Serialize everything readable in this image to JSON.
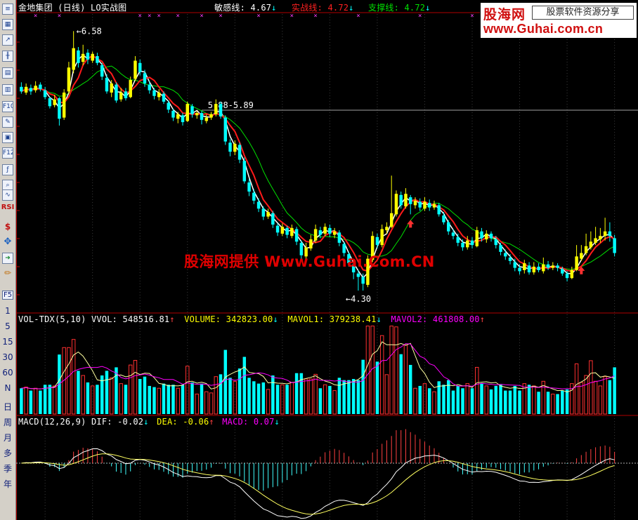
{
  "toolbar": {
    "icons": [
      "list-icon",
      "grid-icon",
      "line-chart-icon",
      "candlestick-icon",
      "table-icon",
      "report-icon",
      "f10-icon",
      "notes-icon",
      "document-icon",
      "f12-icon",
      "formula-icon",
      "search-icon",
      "indicator-icon",
      "rsi-icon",
      "money-icon",
      "move-icon",
      "exit-icon",
      "pencil-icon",
      "f5-icon"
    ],
    "rsi_label": "RSI",
    "f5_label": "F5",
    "period_buttons": [
      "1",
      "5",
      "15",
      "30",
      "60",
      "N",
      "日",
      "周",
      "月",
      "多",
      "季",
      "年"
    ]
  },
  "header": {
    "stock_name": "金地集团",
    "period": "(日线)",
    "chart_name": "LO实战图",
    "sensitive_label": "敏感线:",
    "sensitive_value": "4.67",
    "sensitive_arrow": "↓",
    "combat_label": "实战线:",
    "combat_value": "4.72",
    "combat_arrow": "↓",
    "support_label": "支撑线:",
    "support_value": "4.72",
    "support_arrow": "↓"
  },
  "logo": {
    "name": "股海网",
    "tagline": "股票软件资源分享",
    "url": "www.Guhai.com.cn"
  },
  "watermark": "股海网提供 Www.Guhai.Com.CN",
  "colors": {
    "background": "#000000",
    "up": "#ffff00",
    "down": "#00ffff",
    "red_line": "#ff1a1a",
    "green_line": "#00e000",
    "white_line": "#ffffff",
    "magenta": "#ff00ff",
    "divider": "#b00000"
  },
  "chart_data": [
    {
      "type": "candlestick",
      "title": "金地集团 (日线) LO实战图",
      "ylim": [
        4.14,
        6.73
      ],
      "annotations": {
        "high_label": "6.58",
        "low_label": "4.30",
        "resistance_label": "5.88-5.89",
        "resistance_level": 5.885
      },
      "series": {
        "sensitive": 4.67,
        "combat": 4.72,
        "support": 4.72
      },
      "candles": [
        {
          "o": 6.09,
          "c": 6.05,
          "h": 6.13,
          "l": 6.03
        },
        {
          "o": 6.04,
          "c": 6.09,
          "h": 6.12,
          "l": 6.02
        },
        {
          "o": 6.08,
          "c": 6.05,
          "h": 6.11,
          "l": 6.02
        },
        {
          "o": 6.06,
          "c": 6.1,
          "h": 6.14,
          "l": 6.04
        },
        {
          "o": 6.11,
          "c": 6.07,
          "h": 6.13,
          "l": 6.05
        },
        {
          "o": 6.06,
          "c": 6.0,
          "h": 6.09,
          "l": 5.98
        },
        {
          "o": 5.99,
          "c": 5.92,
          "h": 6.0,
          "l": 5.9
        },
        {
          "o": 5.93,
          "c": 5.98,
          "h": 6.02,
          "l": 5.91
        },
        {
          "o": 5.99,
          "c": 5.81,
          "h": 6.0,
          "l": 5.75
        },
        {
          "o": 5.82,
          "c": 6.04,
          "h": 6.07,
          "l": 5.8
        },
        {
          "o": 6.05,
          "c": 6.26,
          "h": 6.31,
          "l": 6.03
        },
        {
          "o": 6.24,
          "c": 6.43,
          "h": 6.58,
          "l": 6.21
        },
        {
          "o": 6.41,
          "c": 6.3,
          "h": 6.44,
          "l": 6.26
        },
        {
          "o": 6.31,
          "c": 6.38,
          "h": 6.46,
          "l": 6.28
        },
        {
          "o": 6.39,
          "c": 6.33,
          "h": 6.42,
          "l": 6.29
        },
        {
          "o": 6.32,
          "c": 6.38,
          "h": 6.4,
          "l": 6.3
        },
        {
          "o": 6.36,
          "c": 6.3,
          "h": 6.39,
          "l": 6.28
        },
        {
          "o": 6.28,
          "c": 6.18,
          "h": 6.3,
          "l": 6.15
        },
        {
          "o": 6.17,
          "c": 6.05,
          "h": 6.2,
          "l": 6.03
        },
        {
          "o": 6.04,
          "c": 6.12,
          "h": 6.15,
          "l": 6.0
        },
        {
          "o": 6.11,
          "c": 5.97,
          "h": 6.13,
          "l": 5.95
        },
        {
          "o": 5.98,
          "c": 6.04,
          "h": 6.08,
          "l": 5.96
        },
        {
          "o": 6.05,
          "c": 5.99,
          "h": 6.08,
          "l": 5.97
        },
        {
          "o": 6.0,
          "c": 6.15,
          "h": 6.18,
          "l": 5.99
        },
        {
          "o": 6.16,
          "c": 6.32,
          "h": 6.36,
          "l": 6.14
        },
        {
          "o": 6.3,
          "c": 6.22,
          "h": 6.33,
          "l": 6.19
        },
        {
          "o": 6.21,
          "c": 6.12,
          "h": 6.24,
          "l": 6.09
        },
        {
          "o": 6.11,
          "c": 6.06,
          "h": 6.14,
          "l": 6.03
        },
        {
          "o": 6.06,
          "c": 6.01,
          "h": 6.08,
          "l": 5.98
        },
        {
          "o": 6.0,
          "c": 6.04,
          "h": 6.07,
          "l": 5.97
        },
        {
          "o": 6.03,
          "c": 5.96,
          "h": 6.05,
          "l": 5.94
        },
        {
          "o": 5.95,
          "c": 5.89,
          "h": 5.97,
          "l": 5.86
        },
        {
          "o": 5.88,
          "c": 5.82,
          "h": 5.9,
          "l": 5.79
        },
        {
          "o": 5.81,
          "c": 5.85,
          "h": 5.87,
          "l": 5.77
        },
        {
          "o": 5.84,
          "c": 5.78,
          "h": 5.86,
          "l": 5.75
        },
        {
          "o": 5.79,
          "c": 5.94,
          "h": 5.96,
          "l": 5.78
        },
        {
          "o": 5.92,
          "c": 5.85,
          "h": 5.94,
          "l": 5.82
        },
        {
          "o": 5.84,
          "c": 5.86,
          "h": 5.88,
          "l": 5.81
        },
        {
          "o": 5.86,
          "c": 5.8,
          "h": 5.88,
          "l": 5.76
        },
        {
          "o": 5.79,
          "c": 5.82,
          "h": 5.85,
          "l": 5.77
        },
        {
          "o": 5.82,
          "c": 5.85,
          "h": 5.87,
          "l": 5.8
        },
        {
          "o": 5.85,
          "c": 5.94,
          "h": 5.98,
          "l": 5.83
        },
        {
          "o": 5.94,
          "c": 5.83,
          "h": 5.96,
          "l": 5.81
        },
        {
          "o": 5.82,
          "c": 5.61,
          "h": 5.84,
          "l": 5.58
        },
        {
          "o": 5.6,
          "c": 5.52,
          "h": 5.63,
          "l": 5.48
        },
        {
          "o": 5.52,
          "c": 5.59,
          "h": 5.62,
          "l": 5.49
        },
        {
          "o": 5.58,
          "c": 5.45,
          "h": 5.6,
          "l": 5.42
        },
        {
          "o": 5.44,
          "c": 5.26,
          "h": 5.47,
          "l": 5.24
        },
        {
          "o": 5.25,
          "c": 5.17,
          "h": 5.28,
          "l": 5.13
        },
        {
          "o": 5.16,
          "c": 5.09,
          "h": 5.19,
          "l": 5.06
        },
        {
          "o": 5.08,
          "c": 5.02,
          "h": 5.11,
          "l": 4.99
        },
        {
          "o": 5.02,
          "c": 4.95,
          "h": 5.04,
          "l": 4.92
        },
        {
          "o": 4.95,
          "c": 4.99,
          "h": 5.02,
          "l": 4.93
        },
        {
          "o": 4.98,
          "c": 4.88,
          "h": 5.0,
          "l": 4.85
        },
        {
          "o": 4.87,
          "c": 4.81,
          "h": 4.89,
          "l": 4.78
        },
        {
          "o": 4.8,
          "c": 4.86,
          "h": 4.89,
          "l": 4.78
        },
        {
          "o": 4.85,
          "c": 4.79,
          "h": 4.87,
          "l": 4.76
        },
        {
          "o": 4.78,
          "c": 4.85,
          "h": 4.88,
          "l": 4.76
        },
        {
          "o": 4.84,
          "c": 4.73,
          "h": 4.86,
          "l": 4.7
        },
        {
          "o": 4.72,
          "c": 4.61,
          "h": 4.74,
          "l": 4.58
        },
        {
          "o": 4.6,
          "c": 4.68,
          "h": 4.72,
          "l": 4.58
        },
        {
          "o": 4.67,
          "c": 4.75,
          "h": 4.79,
          "l": 4.65
        },
        {
          "o": 4.74,
          "c": 4.84,
          "h": 4.88,
          "l": 4.72
        },
        {
          "o": 4.83,
          "c": 4.79,
          "h": 4.86,
          "l": 4.76
        },
        {
          "o": 4.8,
          "c": 4.86,
          "h": 4.89,
          "l": 4.78
        },
        {
          "o": 4.85,
          "c": 4.8,
          "h": 4.88,
          "l": 4.77
        },
        {
          "o": 4.79,
          "c": 4.82,
          "h": 4.85,
          "l": 4.76
        },
        {
          "o": 4.81,
          "c": 4.72,
          "h": 4.83,
          "l": 4.69
        },
        {
          "o": 4.71,
          "c": 4.63,
          "h": 4.73,
          "l": 4.6
        },
        {
          "o": 4.62,
          "c": 4.54,
          "h": 4.64,
          "l": 4.51
        },
        {
          "o": 4.53,
          "c": 4.46,
          "h": 4.55,
          "l": 4.4
        },
        {
          "o": 4.45,
          "c": 4.42,
          "h": 4.48,
          "l": 4.3
        },
        {
          "o": 4.42,
          "c": 4.36,
          "h": 4.45,
          "l": 4.3
        },
        {
          "o": 4.35,
          "c": 4.58,
          "h": 4.61,
          "l": 4.33
        },
        {
          "o": 4.57,
          "c": 4.78,
          "h": 4.82,
          "l": 4.55
        },
        {
          "o": 4.77,
          "c": 4.7,
          "h": 4.8,
          "l": 4.67
        },
        {
          "o": 4.7,
          "c": 4.84,
          "h": 4.88,
          "l": 4.68
        },
        {
          "o": 4.83,
          "c": 4.86,
          "h": 4.9,
          "l": 4.8
        },
        {
          "o": 4.86,
          "c": 4.98,
          "h": 5.31,
          "l": 4.85
        },
        {
          "o": 4.97,
          "c": 5.15,
          "h": 5.18,
          "l": 4.95
        },
        {
          "o": 5.14,
          "c": 5.05,
          "h": 5.17,
          "l": 5.02
        },
        {
          "o": 5.04,
          "c": 5.15,
          "h": 5.2,
          "l": 5.02
        },
        {
          "o": 5.12,
          "c": 5.06,
          "h": 5.14,
          "l": 4.97
        },
        {
          "o": 5.05,
          "c": 5.09,
          "h": 5.12,
          "l": 5.02
        },
        {
          "o": 5.08,
          "c": 5.03,
          "h": 5.11,
          "l": 5.0
        },
        {
          "o": 5.02,
          "c": 5.08,
          "h": 5.12,
          "l": 5.0
        },
        {
          "o": 5.07,
          "c": 5.03,
          "h": 5.1,
          "l": 5.0
        },
        {
          "o": 5.03,
          "c": 5.06,
          "h": 5.09,
          "l": 5.01
        },
        {
          "o": 5.05,
          "c": 4.97,
          "h": 5.07,
          "l": 4.95
        },
        {
          "o": 4.96,
          "c": 4.9,
          "h": 4.99,
          "l": 4.88
        },
        {
          "o": 4.9,
          "c": 4.82,
          "h": 4.92,
          "l": 4.79
        },
        {
          "o": 4.81,
          "c": 4.78,
          "h": 4.84,
          "l": 4.75
        },
        {
          "o": 4.77,
          "c": 4.72,
          "h": 4.8,
          "l": 4.69
        },
        {
          "o": 4.72,
          "c": 4.68,
          "h": 4.75,
          "l": 4.65
        },
        {
          "o": 4.68,
          "c": 4.74,
          "h": 4.78,
          "l": 4.66
        },
        {
          "o": 4.74,
          "c": 4.7,
          "h": 4.77,
          "l": 4.67
        },
        {
          "o": 4.69,
          "c": 4.83,
          "h": 4.86,
          "l": 4.68
        },
        {
          "o": 4.82,
          "c": 4.76,
          "h": 4.85,
          "l": 4.73
        },
        {
          "o": 4.75,
          "c": 4.8,
          "h": 4.83,
          "l": 4.72
        },
        {
          "o": 4.8,
          "c": 4.76,
          "h": 4.82,
          "l": 4.73
        },
        {
          "o": 4.75,
          "c": 4.7,
          "h": 4.78,
          "l": 4.67
        },
        {
          "o": 4.7,
          "c": 4.64,
          "h": 4.72,
          "l": 4.61
        },
        {
          "o": 4.63,
          "c": 4.6,
          "h": 4.66,
          "l": 4.57
        },
        {
          "o": 4.59,
          "c": 4.56,
          "h": 4.62,
          "l": 4.53
        },
        {
          "o": 4.55,
          "c": 4.5,
          "h": 4.58,
          "l": 4.47
        },
        {
          "o": 4.5,
          "c": 4.47,
          "h": 4.53,
          "l": 4.44
        },
        {
          "o": 4.48,
          "c": 4.54,
          "h": 4.57,
          "l": 4.45
        },
        {
          "o": 4.52,
          "c": 4.46,
          "h": 4.55,
          "l": 4.44
        },
        {
          "o": 4.46,
          "c": 4.51,
          "h": 4.55,
          "l": 4.44
        },
        {
          "o": 4.51,
          "c": 4.48,
          "h": 4.54,
          "l": 4.46
        },
        {
          "o": 4.47,
          "c": 4.53,
          "h": 4.59,
          "l": 4.45
        },
        {
          "o": 4.53,
          "c": 4.5,
          "h": 4.56,
          "l": 4.48
        },
        {
          "o": 4.5,
          "c": 4.52,
          "h": 4.55,
          "l": 4.48
        },
        {
          "o": 4.52,
          "c": 4.5,
          "h": 4.54,
          "l": 4.47
        },
        {
          "o": 4.49,
          "c": 4.45,
          "h": 4.51,
          "l": 4.43
        },
        {
          "o": 4.45,
          "c": 4.41,
          "h": 4.47,
          "l": 4.38
        },
        {
          "o": 4.41,
          "c": 4.48,
          "h": 4.51,
          "l": 4.4
        },
        {
          "o": 4.48,
          "c": 4.6,
          "h": 4.7,
          "l": 4.47
        },
        {
          "o": 4.58,
          "c": 4.63,
          "h": 4.7,
          "l": 4.56
        },
        {
          "o": 4.63,
          "c": 4.69,
          "h": 4.8,
          "l": 4.61
        },
        {
          "o": 4.68,
          "c": 4.73,
          "h": 4.82,
          "l": 4.66
        },
        {
          "o": 4.72,
          "c": 4.76,
          "h": 4.86,
          "l": 4.7
        },
        {
          "o": 4.75,
          "c": 4.78,
          "h": 4.85,
          "l": 4.72
        },
        {
          "o": 4.78,
          "c": 4.82,
          "h": 4.94,
          "l": 4.74
        },
        {
          "o": 4.82,
          "c": 4.78,
          "h": 4.9,
          "l": 4.73
        },
        {
          "o": 4.76,
          "c": 4.63,
          "h": 4.79,
          "l": 4.6
        }
      ],
      "signal_arrows_index": [
        82,
        118
      ]
    },
    {
      "type": "bar",
      "title": "VOL-TDX(5,10)",
      "vvol_label": "VVOL:",
      "vvol_value": "548516.81",
      "vvol_arrow": "↑",
      "volume_label": "VOLUME:",
      "volume_value": "342823.00",
      "volume_arrow": "↓",
      "mavol1_label": "MAVOL1:",
      "mavol1_value": "379238.41",
      "mavol1_arrow": "↓",
      "mavol2_label": "MAVOL2:",
      "mavol2_value": "461808.00",
      "mavol2_arrow": "↑",
      "ylim": [
        0,
        1700000
      ]
    },
    {
      "type": "line",
      "title": "MACD(12,26,9)",
      "dif_label": "DIF:",
      "dif_value": "-0.02",
      "dif_arrow": "↓",
      "dea_label": "DEA:",
      "dea_value": "-0.06",
      "dea_arrow": "↑",
      "macd_label": "MACD:",
      "macd_value": "0.07",
      "macd_arrow": "↓"
    }
  ]
}
